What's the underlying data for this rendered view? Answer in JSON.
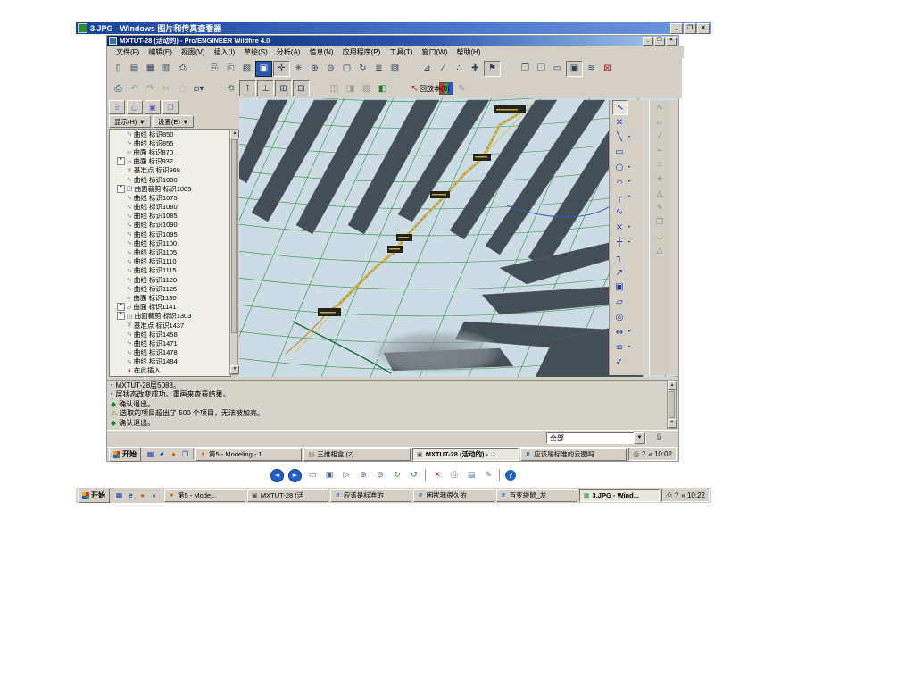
{
  "outer_window": {
    "title": "3.JPG - Windows 图片和传真查看器",
    "controls": {
      "minimize": "_",
      "restore": "❐",
      "close": "×"
    }
  },
  "proe": {
    "title": "MXTUT-28 (活动的) - Pro/ENGINEER Wildfire 4.0",
    "controls": {
      "minimize": "_",
      "restore": "❐",
      "close": "×"
    },
    "menus": [
      {
        "label": "文件(F)"
      },
      {
        "label": "编辑(E)"
      },
      {
        "label": "视图(V)"
      },
      {
        "label": "插入(I)"
      },
      {
        "label": "草绘(S)"
      },
      {
        "label": "分析(A)"
      },
      {
        "label": "信息(N)"
      },
      {
        "label": "应用程序(P)"
      },
      {
        "label": "工具(T)"
      },
      {
        "label": "窗口(W)"
      },
      {
        "label": "帮助(H)"
      }
    ],
    "toolbar_row1": [
      {
        "name": "new-file-button",
        "glyph": "▯"
      },
      {
        "name": "open-file-button",
        "glyph": "▤"
      },
      {
        "name": "erase-button",
        "glyph": "▦",
        "cls": ""
      },
      {
        "name": "save-file-button",
        "glyph": "▥"
      },
      {
        "name": "print-button",
        "glyph": "⎙"
      },
      {
        "name": "separator",
        "glyph": "",
        "cls": "sep"
      },
      {
        "name": "copy-button",
        "glyph": "⎘"
      },
      {
        "name": "paste-button",
        "glyph": "⎗"
      },
      {
        "name": "paste-special-button",
        "glyph": "▨"
      },
      {
        "name": "shaded-view-button",
        "glyph": "▣",
        "cls": "blue"
      },
      {
        "name": "spin-center-button",
        "glyph": "✛",
        "cls": "pressed"
      },
      {
        "name": "shade-button",
        "glyph": "✳"
      },
      {
        "name": "zoom-in-button",
        "glyph": "⊕"
      },
      {
        "name": "zoom-out-button",
        "glyph": "⊖"
      },
      {
        "name": "refit-button",
        "glyph": "▢"
      },
      {
        "name": "saved-views-button",
        "glyph": "↻"
      },
      {
        "name": "layers-button",
        "glyph": "≣"
      },
      {
        "name": "view-manager-button",
        "glyph": "▧"
      },
      {
        "name": "separator",
        "glyph": "",
        "cls": "sep"
      },
      {
        "name": "datum-plane-toggle",
        "glyph": "⊿"
      },
      {
        "name": "datum-axis-toggle",
        "glyph": "⁄"
      },
      {
        "name": "datum-point-toggle",
        "glyph": "∴"
      },
      {
        "name": "datum-csys-toggle",
        "glyph": "✚"
      },
      {
        "name": "annotation-toggle",
        "glyph": "⚑",
        "cls": "pressed"
      },
      {
        "name": "separator",
        "glyph": "",
        "cls": "sep"
      },
      {
        "name": "window-button",
        "glyph": "❐"
      },
      {
        "name": "window-copy-button",
        "glyph": "❑"
      },
      {
        "name": "window-open-button",
        "glyph": "▭"
      },
      {
        "name": "window-new-button",
        "glyph": "▣",
        "cls": "pressed"
      },
      {
        "name": "window-tile-button",
        "glyph": "≋"
      },
      {
        "name": "window-close-button",
        "glyph": "⊠",
        "cls": "red"
      }
    ],
    "toolbar_row2": [
      {
        "name": "print2-button",
        "glyph": "⎙"
      },
      {
        "name": "undo-button",
        "glyph": "↶",
        "cls": "dis"
      },
      {
        "name": "redo-button",
        "glyph": "↷",
        "cls": "dis"
      },
      {
        "name": "cut-button",
        "glyph": "✂",
        "cls": "dis"
      },
      {
        "name": "find-button",
        "glyph": "◌",
        "cls": "dis"
      },
      {
        "name": "selection-filter-button",
        "glyph": "▫▾"
      },
      {
        "name": "separator",
        "glyph": "",
        "cls": "sep"
      },
      {
        "name": "regenerate-button",
        "glyph": "⟲",
        "cls": "green"
      },
      {
        "name": "feature-tool-1-button",
        "glyph": "⊺",
        "cls": "pressed"
      },
      {
        "name": "feature-tool-2-button",
        "glyph": "⊥",
        "cls": "pressed"
      },
      {
        "name": "feature-tool-3-button",
        "glyph": "⊞",
        "cls": "pressed"
      },
      {
        "name": "feature-tool-4-button",
        "glyph": "⊟",
        "cls": "pressed"
      },
      {
        "name": "separator",
        "glyph": "",
        "cls": "sep"
      },
      {
        "name": "geom-tool-1-button",
        "glyph": "◫",
        "cls": "dis"
      },
      {
        "name": "geom-tool-2-button",
        "glyph": "◨",
        "cls": "dis"
      },
      {
        "name": "geom-tool-3-button",
        "glyph": "▨",
        "cls": "dis"
      },
      {
        "name": "geom-tool-4-button",
        "glyph": "◧",
        "cls": "green"
      },
      {
        "name": "separator",
        "glyph": "",
        "cls": "sep"
      },
      {
        "name": "smart-select-button",
        "glyph": "↖",
        "cls": "red"
      },
      {
        "name": "separator",
        "glyph": "",
        "cls": "sep"
      },
      {
        "name": "appearance-colors-button",
        "glyph": "",
        "cls": "rainbow"
      },
      {
        "name": "brush-button",
        "glyph": "✎",
        "cls": "dis"
      }
    ],
    "replay_label": "回放本(0)",
    "navigator": {
      "show_button": "显示(H) ▼",
      "settings_button": "设置(E) ▼",
      "tabs": [
        {
          "name": "tab-model-tree",
          "glyph": "⠿"
        },
        {
          "name": "tab-folder-browser",
          "glyph": "❑"
        },
        {
          "name": "tab-favorites",
          "glyph": "▣"
        },
        {
          "name": "tab-history",
          "glyph": "❒"
        }
      ],
      "tree": [
        {
          "expand": "",
          "cls": "c-curve",
          "glyph": "∿",
          "label": "曲线 标识850"
        },
        {
          "expand": "",
          "cls": "c-curve",
          "glyph": "∿",
          "label": "曲线 标识855"
        },
        {
          "expand": "",
          "cls": "c-surf",
          "glyph": "▱",
          "label": "曲面 标识870"
        },
        {
          "expand": "+",
          "cls": "c-surf",
          "glyph": "▱",
          "label": "曲面 标识932"
        },
        {
          "expand": "",
          "cls": "c-point",
          "glyph": "✕",
          "label": "基准点 标识968"
        },
        {
          "expand": "",
          "cls": "c-curve",
          "glyph": "∿",
          "label": "曲线 标识1000"
        },
        {
          "expand": "+",
          "cls": "c-trim",
          "glyph": "◳",
          "label": "曲面裁剪 标识1005"
        },
        {
          "expand": "",
          "cls": "c-curve",
          "glyph": "∿",
          "label": "曲线 标识1075"
        },
        {
          "expand": "",
          "cls": "c-curve",
          "glyph": "∿",
          "label": "曲线 标识1080"
        },
        {
          "expand": "",
          "cls": "c-curve",
          "glyph": "∿",
          "label": "曲线 标识1085"
        },
        {
          "expand": "",
          "cls": "c-curve",
          "glyph": "∿",
          "label": "曲线 标识1090"
        },
        {
          "expand": "",
          "cls": "c-curve",
          "glyph": "∿",
          "label": "曲线 标识1095"
        },
        {
          "expand": "",
          "cls": "c-curve",
          "glyph": "∿",
          "label": "曲线 标识1100"
        },
        {
          "expand": "",
          "cls": "c-curve",
          "glyph": "∿",
          "label": "曲线 标识1105"
        },
        {
          "expand": "",
          "cls": "c-curve",
          "glyph": "∿",
          "label": "曲线 标识1110"
        },
        {
          "expand": "",
          "cls": "c-curve",
          "glyph": "∿",
          "label": "曲线 标识1115"
        },
        {
          "expand": "",
          "cls": "c-curve",
          "glyph": "∿",
          "label": "曲线 标识1120"
        },
        {
          "expand": "",
          "cls": "c-curve",
          "glyph": "∿",
          "label": "曲线 标识1125"
        },
        {
          "expand": "",
          "cls": "c-surf",
          "glyph": "▱",
          "label": "曲面 标识1130"
        },
        {
          "expand": "+",
          "cls": "c-surf",
          "glyph": "▱",
          "label": "曲面 标识1141"
        },
        {
          "expand": "+",
          "cls": "c-trim",
          "glyph": "◳",
          "label": "曲面裁剪 标识1303"
        },
        {
          "expand": "",
          "cls": "c-point",
          "glyph": "✕",
          "label": "基准点 标识1437"
        },
        {
          "expand": "",
          "cls": "c-curve",
          "glyph": "∿",
          "label": "曲线 标识1458"
        },
        {
          "expand": "",
          "cls": "c-curve",
          "glyph": "∿",
          "label": "曲线 标识1471"
        },
        {
          "expand": "",
          "cls": "c-curve",
          "glyph": "∿",
          "label": "曲线 标识1478"
        },
        {
          "expand": "",
          "cls": "c-curve",
          "glyph": "∿",
          "label": "曲线 标识1484"
        },
        {
          "expand": "",
          "cls": "c-ins",
          "glyph": "➧",
          "label": "在此插入"
        }
      ]
    },
    "sketch_tools": [
      {
        "name": "select-arrow-button",
        "glyph": "↖",
        "cls": "pressed",
        "fly": ""
      },
      {
        "name": "delete-x-button",
        "glyph": "✕",
        "cls": "",
        "fly": ""
      },
      {
        "name": "line-tool-button",
        "glyph": "╲",
        "cls": "",
        "fly": "•"
      },
      {
        "name": "rectangle-tool-button",
        "glyph": "▭",
        "cls": "",
        "fly": ""
      },
      {
        "name": "circle-tool-button",
        "glyph": "○",
        "cls": "",
        "fly": "•"
      },
      {
        "name": "arc-tool-button",
        "glyph": "⌒",
        "cls": "",
        "fly": "•"
      },
      {
        "name": "fillet-tool-button",
        "glyph": "╭",
        "cls": "",
        "fly": "•"
      },
      {
        "name": "spline-tool-button",
        "glyph": "∿",
        "cls": "",
        "fly": ""
      },
      {
        "name": "point-tool-button",
        "glyph": "×",
        "cls": "",
        "fly": "•"
      },
      {
        "name": "csys-tool-button",
        "glyph": "┼",
        "cls": "",
        "fly": "•"
      },
      {
        "name": "chamfer-tool-button",
        "glyph": "┐",
        "cls": "",
        "fly": ""
      },
      {
        "name": "trim-tool-button",
        "glyph": "↗",
        "cls": "",
        "fly": ""
      },
      {
        "name": "text-tool-button",
        "glyph": "▣",
        "cls": "",
        "fly": ""
      },
      {
        "name": "offset-tool-button",
        "glyph": "▱",
        "cls": "",
        "fly": ""
      },
      {
        "name": "ellipse-tool-button",
        "glyph": "◎",
        "cls": "",
        "fly": ""
      },
      {
        "name": "dimension-tool-button",
        "glyph": "↔",
        "cls": "",
        "fly": "•"
      },
      {
        "name": "modify-tool-button",
        "glyph": "≡",
        "cls": "",
        "fly": "•"
      },
      {
        "name": "done-check-button",
        "glyph": "✓",
        "cls": "",
        "fly": ""
      }
    ],
    "right_strip": [
      {
        "name": "datum-curve-icon",
        "glyph": "∿"
      },
      {
        "name": "datum-plane-icon",
        "glyph": "▱"
      },
      {
        "name": "datum-line-icon",
        "glyph": "⁄"
      },
      {
        "name": "datum-spline-icon",
        "glyph": "∼"
      },
      {
        "name": "datum-points-icon",
        "glyph": "⁙"
      },
      {
        "name": "datum-star-icon",
        "glyph": "✳"
      },
      {
        "name": "datum-triangle-icon",
        "glyph": "◬"
      },
      {
        "name": "sketch-pencil-icon",
        "glyph": "✎"
      },
      {
        "name": "shapes-icon",
        "glyph": "❒"
      },
      {
        "name": "arc-strip-icon",
        "glyph": "◡"
      },
      {
        "name": "triangle2-icon",
        "glyph": "△"
      }
    ],
    "messages": [
      {
        "cls": "m-dot",
        "glyph": "▪",
        "text": "MXTUT-28层5088。"
      },
      {
        "cls": "m-dot",
        "glyph": "▪",
        "text": "层状态改变成功。重画来查看结果。"
      },
      {
        "cls": "m-go",
        "glyph": "◆",
        "text": "确认退出。"
      },
      {
        "cls": "m-warn",
        "glyph": "⚠",
        "text": "选取的项目超出了 500 个项目，无法被加亮。"
      },
      {
        "cls": "m-go",
        "glyph": "◆",
        "text": "确认退出。"
      }
    ],
    "filter": {
      "value": "全部",
      "icon": "§"
    },
    "taskbar": {
      "start": "开始",
      "quick": [
        {
          "cls": "q-ico",
          "glyph": "▦"
        },
        {
          "cls": "q-ico tk-ie",
          "glyph": "e"
        },
        {
          "cls": "q-ico tk-ff",
          "glyph": "●"
        },
        {
          "cls": "q-ico",
          "glyph": "❐"
        }
      ],
      "tasks": [
        {
          "ico": "tk-ff",
          "glyph": "●",
          "label": "第5 - Modeling - 1",
          "cls": ""
        },
        {
          "ico": "tk-album",
          "glyph": "▤",
          "label": "三维相盒 (2)",
          "cls": ""
        },
        {
          "ico": "tk-proe",
          "glyph": "▣",
          "label": "MXTUT-28 (活动的) - ...",
          "cls": "active"
        },
        {
          "ico": "tk-ie",
          "glyph": "e",
          "label": "应该是标准的云图吗",
          "cls": ""
        }
      ],
      "tray_icons": [
        {
          "name": "printer-icon",
          "glyph": "⎙"
        },
        {
          "name": "help-icon",
          "glyph": "?"
        }
      ],
      "time": "« 10:02"
    }
  },
  "viewer_toolbar": [
    {
      "name": "previous-image-button",
      "glyph": "◄",
      "cls": "vb-blue"
    },
    {
      "name": "next-image-button",
      "glyph": "►",
      "cls": "vb-blue"
    },
    {
      "name": "best-fit-button",
      "glyph": "▭",
      "cls": ""
    },
    {
      "name": "actual-size-button",
      "glyph": "▣",
      "cls": ""
    },
    {
      "name": "slideshow-button",
      "glyph": "▷",
      "cls": ""
    },
    {
      "name": "zoom-in-button",
      "glyph": "⊕",
      "cls": ""
    },
    {
      "name": "zoom-out-button",
      "glyph": "⊖",
      "cls": ""
    },
    {
      "name": "rotate-clockwise-button",
      "glyph": "↻",
      "cls": "vb-green"
    },
    {
      "name": "rotate-counterclockwise-button",
      "glyph": "↺",
      "cls": "vb-green"
    },
    {
      "name": "separator",
      "glyph": "",
      "cls": "vb-sep"
    },
    {
      "name": "delete-button",
      "glyph": "✕",
      "cls": "vb-red"
    },
    {
      "name": "print-button",
      "glyph": "⎙",
      "cls": ""
    },
    {
      "name": "save-button",
      "glyph": "▤",
      "cls": ""
    },
    {
      "name": "edit-button",
      "glyph": "✎",
      "cls": ""
    },
    {
      "name": "separator",
      "glyph": "",
      "cls": "vb-sep"
    },
    {
      "name": "help-button",
      "glyph": "?",
      "cls": "vb-help"
    }
  ],
  "desktop_taskbar": {
    "start": "开始",
    "quick": [
      {
        "cls": "q-ico",
        "glyph": "▦"
      },
      {
        "cls": "q-ico tk-ie",
        "glyph": "e"
      },
      {
        "cls": "q-ico tk-ff",
        "glyph": "●"
      },
      {
        "cls": "q-ico",
        "glyph": "»"
      }
    ],
    "tasks": [
      {
        "ico": "tk-ff",
        "glyph": "●",
        "label": "第5 - Mode...",
        "cls": ""
      },
      {
        "ico": "tk-proe",
        "glyph": "▣",
        "label": "MXTUT-28 (活",
        "cls": ""
      },
      {
        "ico": "tk-ie",
        "glyph": "e",
        "label": "应该是标准的",
        "cls": ""
      },
      {
        "ico": "tk-ie",
        "glyph": "e",
        "label": "困扰我很久的",
        "cls": ""
      },
      {
        "ico": "tk-ie",
        "glyph": "e",
        "label": "百变袋鼠_龙",
        "cls": ""
      },
      {
        "ico": "tk-img",
        "glyph": "▦",
        "label": "3.JPG - Wind...",
        "cls": "active"
      }
    ],
    "tray_icons": [
      {
        "name": "printer-icon",
        "glyph": "⎙"
      },
      {
        "name": "help-icon",
        "glyph": "?"
      }
    ],
    "time": "« 10:22"
  }
}
